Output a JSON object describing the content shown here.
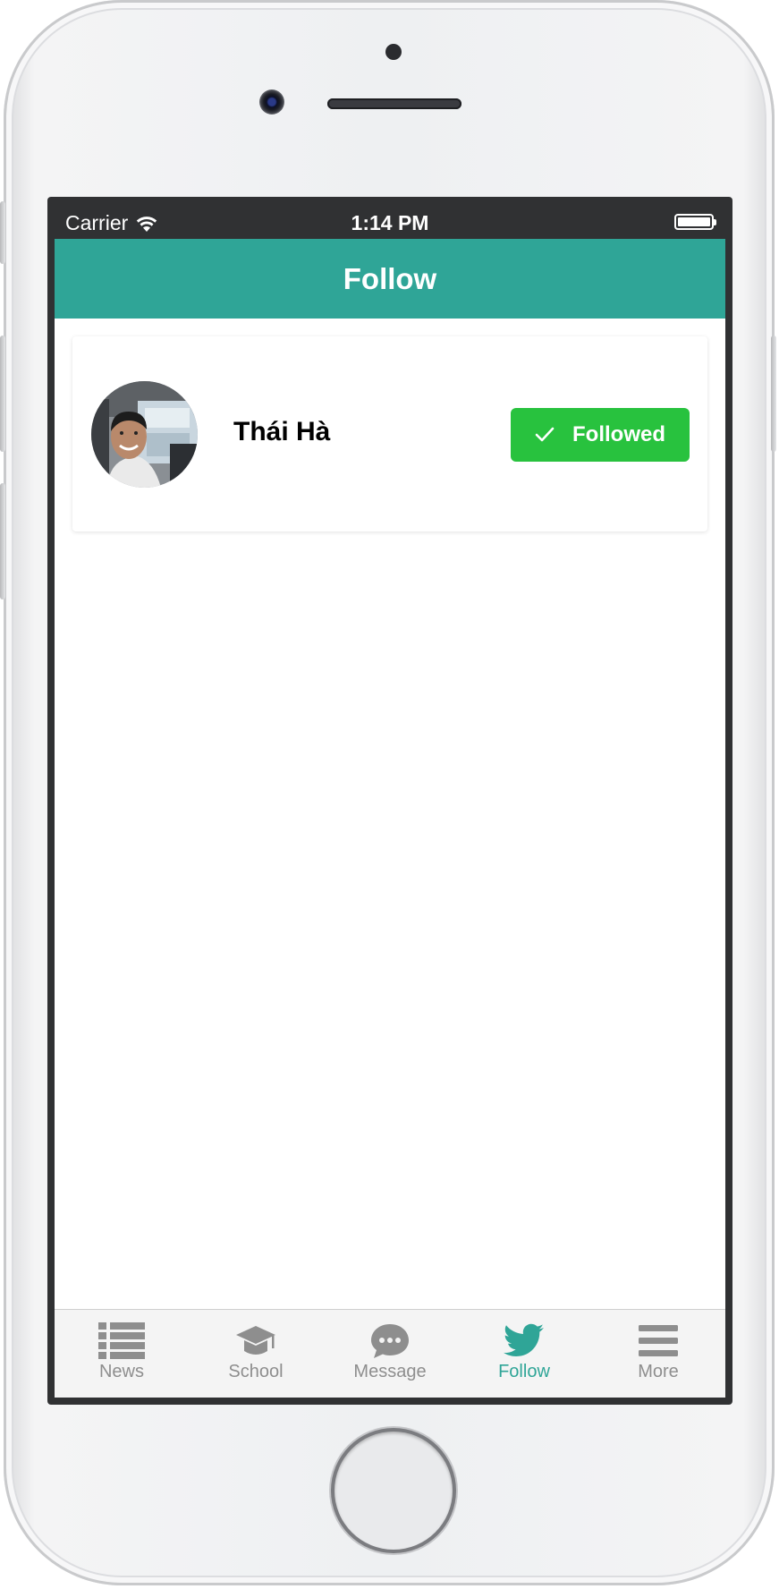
{
  "status_bar": {
    "carrier": "Carrier",
    "time": "1:14 PM"
  },
  "nav": {
    "title": "Follow"
  },
  "follow_list": [
    {
      "name": "Thái Hà",
      "button_label": "Followed",
      "button_icon": "checkmark-icon",
      "followed": true
    }
  ],
  "tabs": [
    {
      "label": "News",
      "icon": "list-icon",
      "active": false
    },
    {
      "label": "School",
      "icon": "graduation-cap-icon",
      "active": false
    },
    {
      "label": "Message",
      "icon": "chat-bubble-icon",
      "active": false
    },
    {
      "label": "Follow",
      "icon": "twitter-bird-icon",
      "active": true
    },
    {
      "label": "More",
      "icon": "menu-icon",
      "active": false
    }
  ],
  "colors": {
    "header": "#2fa597",
    "followed_button": "#28c23e",
    "tab_active": "#2fa597",
    "tab_inactive": "#8e8e8e"
  }
}
